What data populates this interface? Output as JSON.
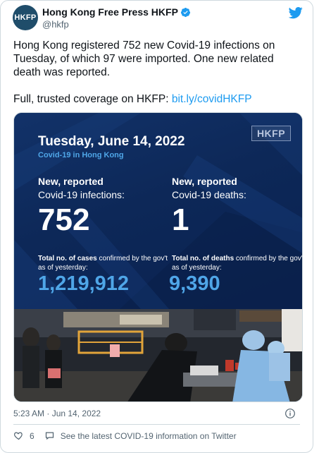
{
  "account": {
    "display_name": "Hong Kong Free Press HKFP",
    "handle": "@hkfp",
    "avatar_text": "HKFP",
    "verified_color": "#1d9bf0"
  },
  "tweet": {
    "text_line1": "Hong Kong registered 752 new Covid-19 infections on Tuesday, of which 97 were imported. One new related death was reported.",
    "text_line2_prefix": "Full, trusted coverage on HKFP: ",
    "text_link": "bit.ly/covidHKFP",
    "timestamp": "5:23 AM · Jun 14, 2022"
  },
  "infographic": {
    "logo": "HKFP",
    "date": "Tuesday, June 14, 2022",
    "subtitle": "Covid-19 in Hong Kong",
    "infections_title": "New, reported",
    "infections_sub": "Covid-19 infections:",
    "infections_value": "752",
    "deaths_title": "New, reported",
    "deaths_sub": "Covid-19 deaths:",
    "deaths_value": "1",
    "cases_total_bold": "Total no. of cases",
    "cases_total_rest": " confirmed by the gov't as of yesterday:",
    "cases_total_value": "1,219,912",
    "deaths_total_bold": "Total no. of deaths",
    "deaths_total_rest": " confirmed by the gov't as of yesterday:",
    "deaths_total_value": "9,390",
    "bg_color": "#0d2858",
    "accent_color": "#4fa6e8"
  },
  "actions": {
    "like_count": "6",
    "latest_info_label": "See the latest COVID-19 information on Twitter"
  },
  "icons": {
    "verified": "verified-badge-icon",
    "twitter": "twitter-bird-icon",
    "info": "info-icon",
    "heart": "heart-icon",
    "speech": "speech-bubble-icon"
  }
}
